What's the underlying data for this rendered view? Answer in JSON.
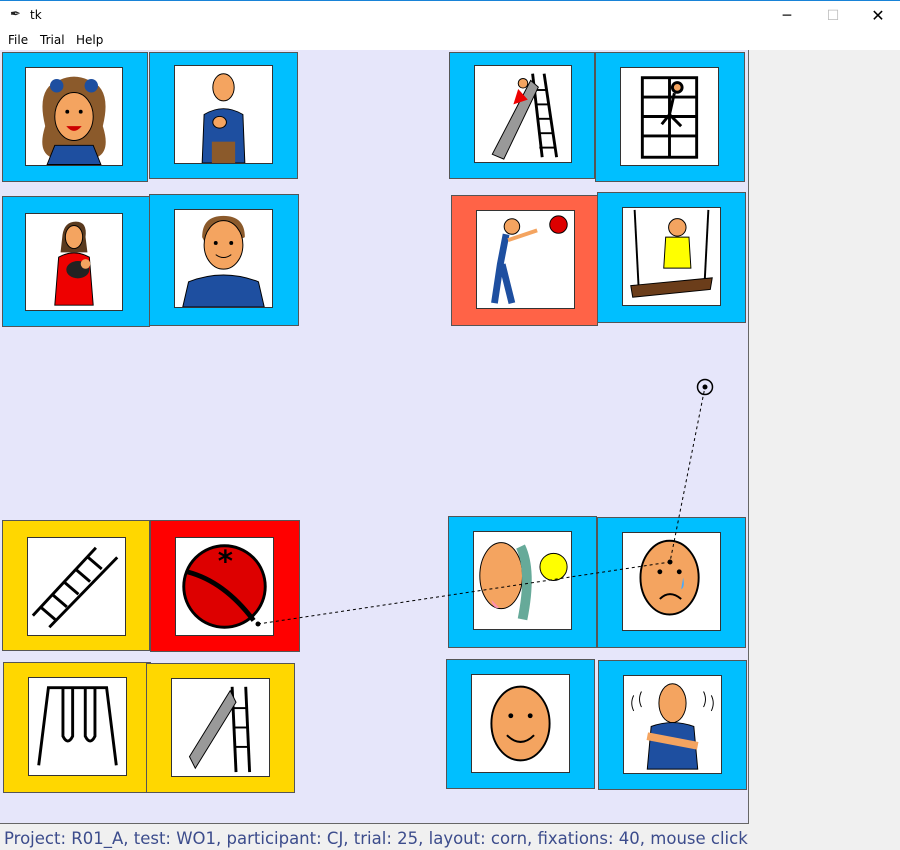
{
  "window": {
    "title": "tk"
  },
  "menu": {
    "file": "File",
    "trial": "Trial",
    "help": "Help"
  },
  "colors": {
    "canvas_bg": "#e6e6fa",
    "card_blue": "#00bfff",
    "card_coral": "#ff6347",
    "card_gold": "#ffd700",
    "card_red": "#ff0000"
  },
  "cards": [
    {
      "name": "card-girl-curly-hair",
      "icon": "girl-curly-hair-icon",
      "color": "#00bfff"
    },
    {
      "name": "card-man-signing",
      "icon": "man-signing-icon",
      "color": "#00bfff"
    },
    {
      "name": "card-child-on-slide",
      "icon": "child-on-slide-icon",
      "color": "#00bfff"
    },
    {
      "name": "card-child-climbing",
      "icon": "child-climbing-icon",
      "color": "#00bfff"
    },
    {
      "name": "card-woman-holding-baby",
      "icon": "woman-holding-baby-icon",
      "color": "#00bfff"
    },
    {
      "name": "card-man-portrait",
      "icon": "man-portrait-icon",
      "color": "#00bfff"
    },
    {
      "name": "card-boy-throwing-ball",
      "icon": "boy-throwing-ball-icon",
      "color": "#ff6347"
    },
    {
      "name": "card-boy-on-swing",
      "icon": "boy-on-swing-icon",
      "color": "#00bfff"
    },
    {
      "name": "card-ladder",
      "icon": "ladder-icon",
      "color": "#ffd700"
    },
    {
      "name": "card-red-ball",
      "icon": "red-ball-icon",
      "color": "#ff0000"
    },
    {
      "name": "card-hot-sun-face",
      "icon": "hot-sun-face-icon",
      "color": "#00bfff"
    },
    {
      "name": "card-sad-face",
      "icon": "sad-face-icon",
      "color": "#00bfff"
    },
    {
      "name": "card-swing-set",
      "icon": "swing-set-icon",
      "color": "#ffd700"
    },
    {
      "name": "card-slide",
      "icon": "slide-icon",
      "color": "#ffd700"
    },
    {
      "name": "card-happy-face",
      "icon": "happy-face-icon",
      "color": "#00bfff"
    },
    {
      "name": "card-cold-shivering-man",
      "icon": "cold-shivering-man-icon",
      "color": "#00bfff"
    }
  ],
  "status": {
    "text": "Project: R01_A, test: WO1, participant: CJ, trial: 25, layout: corn, fixations: 40, mouse click"
  }
}
